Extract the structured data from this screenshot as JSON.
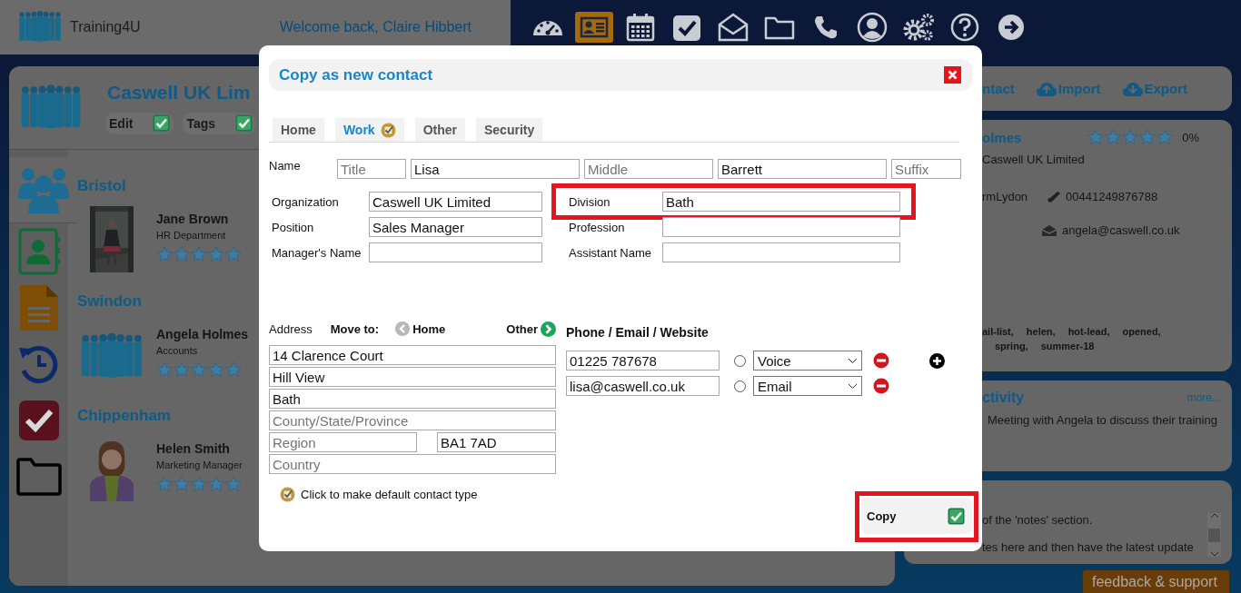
{
  "header": {
    "logo_text": "Training4U",
    "welcome": "Welcome back, Claire Hibbert",
    "nav": [
      {
        "kind": "dashboard",
        "selected": false
      },
      {
        "kind": "contacts",
        "selected": true
      },
      {
        "kind": "calendar",
        "selected": false
      },
      {
        "kind": "tasks",
        "selected": false
      },
      {
        "kind": "mail",
        "selected": false
      },
      {
        "kind": "folder",
        "selected": false
      },
      {
        "kind": "phone",
        "selected": false
      },
      {
        "kind": "profile",
        "selected": false
      },
      {
        "kind": "settings",
        "selected": false
      },
      {
        "kind": "help",
        "selected": false
      },
      {
        "kind": "logout",
        "selected": false
      }
    ]
  },
  "company": {
    "title": "Caswell UK Lim",
    "actions": [
      {
        "label": "Edit",
        "checked": true
      },
      {
        "label": "Tags",
        "checked": true
      }
    ]
  },
  "side_tabs": [
    {
      "kind": "contacts",
      "selected": true
    },
    {
      "kind": "address-book",
      "selected": false
    },
    {
      "kind": "document",
      "selected": false
    },
    {
      "kind": "history",
      "selected": false
    },
    {
      "kind": "tasks",
      "selected": false
    },
    {
      "kind": "folder",
      "selected": false
    }
  ],
  "groups": [
    {
      "name": "Bristol",
      "contacts": [
        {
          "name": "Jane Brown",
          "role": "HR Department",
          "stars": 5
        }
      ]
    },
    {
      "name": "Swindon",
      "contacts": [
        {
          "name": "Angela Holmes",
          "role": "Accounts",
          "kind": "group",
          "stars": 5
        }
      ]
    },
    {
      "name": "Chippenham",
      "contacts": [
        {
          "name": "Helen Smith",
          "role": "Marketing Manager",
          "kind": "person",
          "stars": 5
        }
      ]
    }
  ],
  "right": {
    "toolbar": [
      {
        "kind": "text",
        "label": "ntact"
      },
      {
        "kind": "upload",
        "label": "Import"
      },
      {
        "kind": "download",
        "label": "Export"
      }
    ],
    "contact": {
      "name": "olmes",
      "stars": 5,
      "score": "0%",
      "company": "Caswell UK Limited",
      "owner": "rmLydon",
      "phone": "00441249876788",
      "email": "angela@caswell.co.uk",
      "tag_lines": [
        [
          "ail-list,",
          "helen,",
          "hot-lead,",
          "opened,"
        ],
        [
          "spring,",
          "summer-18"
        ]
      ]
    },
    "activity": {
      "title": "ctivity",
      "more": "more...",
      "text": "Meeting with Angela to discuss their training"
    },
    "notes": {
      "lines": [
        "of the 'notes' section.",
        "tes here and then have the latest update"
      ]
    },
    "feedback": "feedback & support"
  },
  "dialog": {
    "title": "Copy as new contact",
    "tabs": [
      {
        "label": "Home",
        "selected": false,
        "default": false
      },
      {
        "label": "Work",
        "selected": true,
        "default": true
      },
      {
        "label": "Other",
        "selected": false,
        "default": false
      },
      {
        "label": "Security",
        "selected": false,
        "default": false
      }
    ],
    "name_label": "Name",
    "name_fields": [
      {
        "placeholder": "Title"
      },
      {
        "value": "Lisa"
      },
      {
        "placeholder": "Middle"
      },
      {
        "value": "Barrett"
      },
      {
        "placeholder": "Suffix"
      }
    ],
    "fields": [
      {
        "label": "Organization",
        "value": "Caswell UK Limited",
        "highlighted": false
      },
      {
        "label": "Division",
        "value": "Bath",
        "highlighted": true
      },
      {
        "label": "Position",
        "value": "Sales Manager",
        "highlighted": false
      },
      {
        "label": "Profession",
        "highlighted": false
      },
      {
        "label": "Manager's Name",
        "highlighted": false
      },
      {
        "label": "Assistant Name",
        "highlighted": false
      }
    ],
    "address_label": "Address",
    "move_to": "Move to:",
    "move_prev": "Home",
    "move_next": "Other",
    "address": [
      {
        "value": "14 Clarence Court"
      },
      {
        "value": "Hill View"
      },
      {
        "value": "Bath"
      },
      {
        "placeholder": "County/State/Province"
      },
      {
        "placeholder": "Region"
      },
      {
        "value": "BA1 7AD"
      },
      {
        "placeholder": "Country"
      }
    ],
    "phone_heading": "Phone / Email / Website",
    "phones": [
      {
        "value": "01225 787678",
        "selected": false,
        "type": "Voice"
      },
      {
        "value": "lisa@caswell.co.uk",
        "selected": false,
        "type": "Email"
      }
    ],
    "default_note": "Click to make default contact type",
    "copy": {
      "label": "Copy",
      "highlighted": true
    }
  }
}
